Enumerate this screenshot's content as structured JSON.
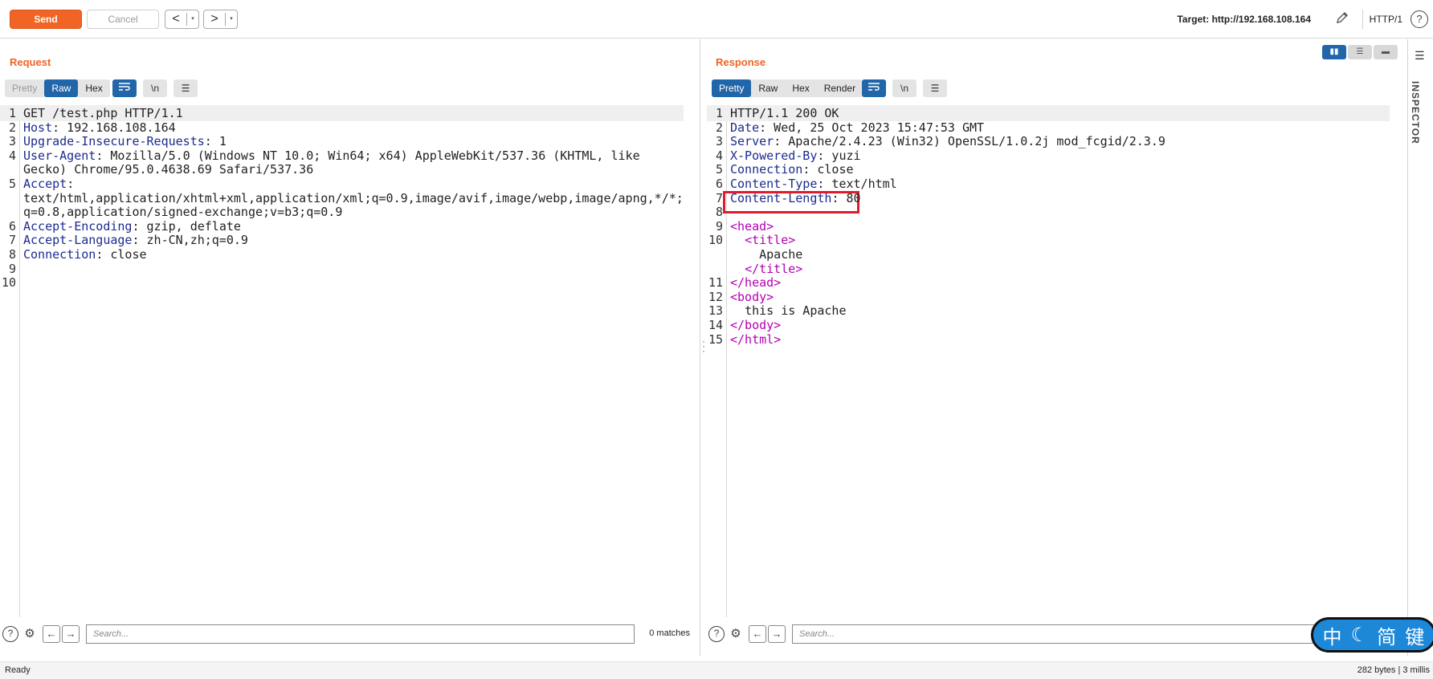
{
  "toolbar": {
    "send_label": "Send",
    "cancel_label": "Cancel",
    "back_label": "<",
    "forward_label": ">",
    "dropdown_glyph": "▾",
    "target_label": "Target: http://192.168.108.164",
    "http_version": "HTTP/1",
    "help_glyph": "?"
  },
  "request": {
    "title": "Request",
    "tabs": [
      "Pretty",
      "Raw",
      "Hex"
    ],
    "active_tab": "Raw",
    "newline_label": "\\n",
    "lines": [
      {
        "n": "1",
        "key": "",
        "val": "GET /test.php HTTP/1.1"
      },
      {
        "n": "2",
        "key": "Host",
        "val": ": 192.168.108.164"
      },
      {
        "n": "3",
        "key": "Upgrade-Insecure-Requests",
        "val": ": 1"
      },
      {
        "n": "4",
        "key": "User-Agent",
        "val": ": Mozilla/5.0 (Windows NT 10.0; Win64; x64) AppleWebKit/537.36 (KHTML, like"
      },
      {
        "n": "",
        "key": "",
        "val": "Gecko) Chrome/95.0.4638.69 Safari/537.36"
      },
      {
        "n": "5",
        "key": "Accept",
        "val": ":"
      },
      {
        "n": "",
        "key": "",
        "val": "text/html,application/xhtml+xml,application/xml;q=0.9,image/avif,image/webp,image/apng,*/*;"
      },
      {
        "n": "",
        "key": "",
        "val": "q=0.8,application/signed-exchange;v=b3;q=0.9"
      },
      {
        "n": "6",
        "key": "Accept-Encoding",
        "val": ": gzip, deflate"
      },
      {
        "n": "7",
        "key": "Accept-Language",
        "val": ": zh-CN,zh;q=0.9"
      },
      {
        "n": "8",
        "key": "Connection",
        "val": ": close"
      },
      {
        "n": "9",
        "key": "",
        "val": ""
      },
      {
        "n": "10",
        "key": "",
        "val": ""
      }
    ],
    "search_placeholder": "Search...",
    "matches": "0 matches"
  },
  "response": {
    "title": "Response",
    "tabs": [
      "Pretty",
      "Raw",
      "Hex",
      "Render"
    ],
    "active_tab": "Pretty",
    "newline_label": "\\n",
    "lines": [
      {
        "n": "1",
        "key": "",
        "val": "HTTP/1.1 200 OK"
      },
      {
        "n": "2",
        "key": "Date",
        "val": ": Wed, 25 Oct 2023 15:47:53 GMT"
      },
      {
        "n": "3",
        "key": "Server",
        "val": ": Apache/2.4.23 (Win32) OpenSSL/1.0.2j mod_fcgid/2.3.9"
      },
      {
        "n": "4",
        "key": "X-Powered-By",
        "val": ": yuzi"
      },
      {
        "n": "5",
        "key": "Connection",
        "val": ": close"
      },
      {
        "n": "6",
        "key": "Content-Type",
        "val": ": text/html"
      },
      {
        "n": "7",
        "key": "Content-Length",
        "val": ": 80"
      },
      {
        "n": "8",
        "key": "",
        "val": ""
      },
      {
        "n": "9",
        "tag": "<head>",
        "indent": ""
      },
      {
        "n": "10",
        "tag": "<title>",
        "indent": "  "
      },
      {
        "n": "",
        "text": "Apache",
        "indent": "    "
      },
      {
        "n": "",
        "tag": "</title>",
        "indent": "  "
      },
      {
        "n": "11",
        "tag": "</head>",
        "indent": ""
      },
      {
        "n": "12",
        "tag": "<body>",
        "indent": ""
      },
      {
        "n": "13",
        "text": "this is Apache",
        "indent": "  "
      },
      {
        "n": "14",
        "tag": "</body>",
        "indent": ""
      },
      {
        "n": "15",
        "tag": "</html>",
        "indent": ""
      }
    ],
    "search_placeholder": "Search..."
  },
  "sidebar": {
    "inspector_label": "INSPECTOR"
  },
  "status": {
    "left": "Ready",
    "right": "282 bytes | 3 millis"
  },
  "ime": {
    "chars": [
      "中",
      "☾",
      "简",
      "键"
    ]
  },
  "colors": {
    "accent": "#f06425",
    "active_tab": "#2266aa",
    "header_key": "#1c2b8f",
    "html_tag": "#b300b3",
    "highlight_box": "#e11b2b"
  }
}
